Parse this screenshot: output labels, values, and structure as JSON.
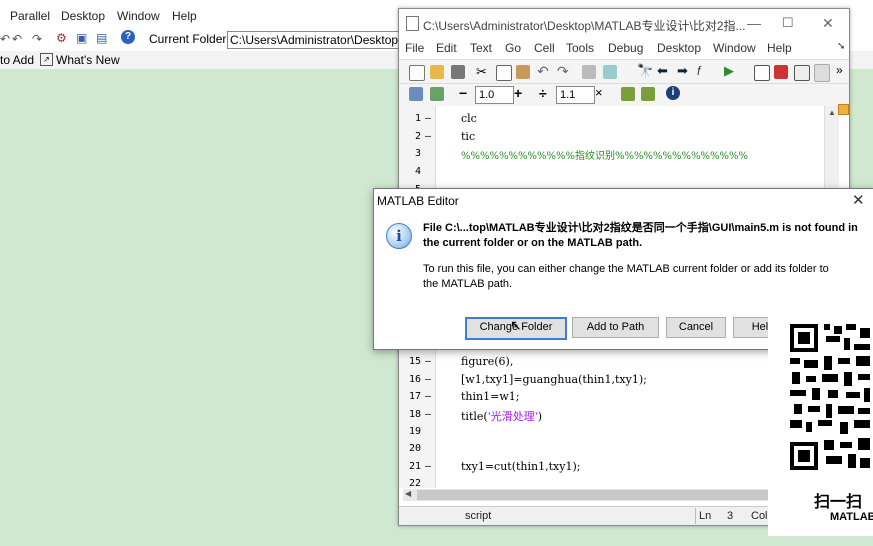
{
  "main_window": {
    "menu": [
      "Parallel",
      "Desktop",
      "Window",
      "Help"
    ],
    "current_folder_label": "Current Folder:",
    "current_folder_value": "C:\\Users\\Administrator\\Desktop\\",
    "shortcuts": [
      "to Add",
      "What's New"
    ]
  },
  "editor": {
    "title": "C:\\Users\\Administrator\\Desktop\\MATLAB专业设计\\比对2指...",
    "menu": [
      "File",
      "Edit",
      "Text",
      "Go",
      "Cell",
      "Tools",
      "Debug",
      "Desktop",
      "Window",
      "Help"
    ],
    "cell_decrement": "1.0",
    "cell_increment": "1.1",
    "code_lines": [
      {
        "n": "1",
        "dash": "—",
        "text": "clc"
      },
      {
        "n": "2",
        "dash": "—",
        "text": "tic"
      },
      {
        "n": "3",
        "dash": "",
        "text": "%%%%%%%%%%%%指纹识别%%%%%%%%%%%%%%"
      },
      {
        "n": "4",
        "dash": "",
        "text": ""
      },
      {
        "n": "5",
        "dash": "",
        "text": ""
      },
      {
        "n": "15",
        "dash": "—",
        "text": "figure(6),"
      },
      {
        "n": "16",
        "dash": "—",
        "text": "[w1,txy1]=guanghua(thin1,txy1);"
      },
      {
        "n": "17",
        "dash": "—",
        "text": "thin1=w1;"
      },
      {
        "n": "18",
        "dash": "—",
        "text": "title('光滑处理')"
      },
      {
        "n": "19",
        "dash": "",
        "text": ""
      },
      {
        "n": "20",
        "dash": "",
        "text": ""
      },
      {
        "n": "21",
        "dash": "—",
        "text": "txy1=cut(thin1,txy1);"
      },
      {
        "n": "22",
        "dash": "",
        "text": ""
      }
    ],
    "status": {
      "mode": "script",
      "ln_label": "Ln",
      "ln_value": "3",
      "col_label": "Col"
    }
  },
  "dialog": {
    "title": "MATLAB Editor",
    "message_bold": "File C:\\...top\\MATLAB专业设计\\比对2指纹是否同一个手指\\GUI\\main5.m is not found in the current folder or on the MATLAB path.",
    "message": "To run this file, you can either change the MATLAB current folder or add its folder to the MATLAB path.",
    "buttons": {
      "change_folder": "Change Folder",
      "add_to_path": "Add to Path",
      "cancel": "Cancel",
      "help": "Help"
    }
  },
  "qr_overlay": {
    "line1": "扫一扫",
    "line2": "MATLAB"
  }
}
